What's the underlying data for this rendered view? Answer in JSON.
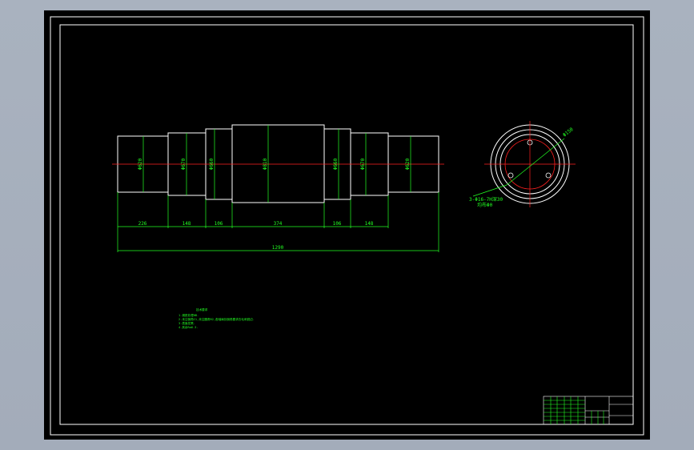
{
  "colors": {
    "background": "#000000",
    "frame": "#ffffff",
    "dimension": "#22ff22",
    "centerline": "#ff2020",
    "app_chrome": "#a7b0bd"
  },
  "front_view": {
    "diameter_labels": [
      "Φ620",
      "Φ670",
      "Φ660",
      "Φ810",
      "Φ660",
      "Φ670",
      "Φ620"
    ],
    "segment_lengths": [
      "226",
      "148",
      "106",
      "374",
      "106",
      "148"
    ],
    "overall_length": "1290"
  },
  "end_view": {
    "diameter_label": "Φ150",
    "hole_callout": "3-Φ16-7H深30",
    "hole_callout_line2": "均布Φ0"
  },
  "tech_notes": {
    "title": "技术要求",
    "lines": [
      "1.调质处理HB.",
      "2.未注倒角C1,未注圆角R2,各轴肩处倒角要求去毛刺锐边.",
      "3.表面发黑.",
      "4.其余Ra6.3."
    ]
  }
}
